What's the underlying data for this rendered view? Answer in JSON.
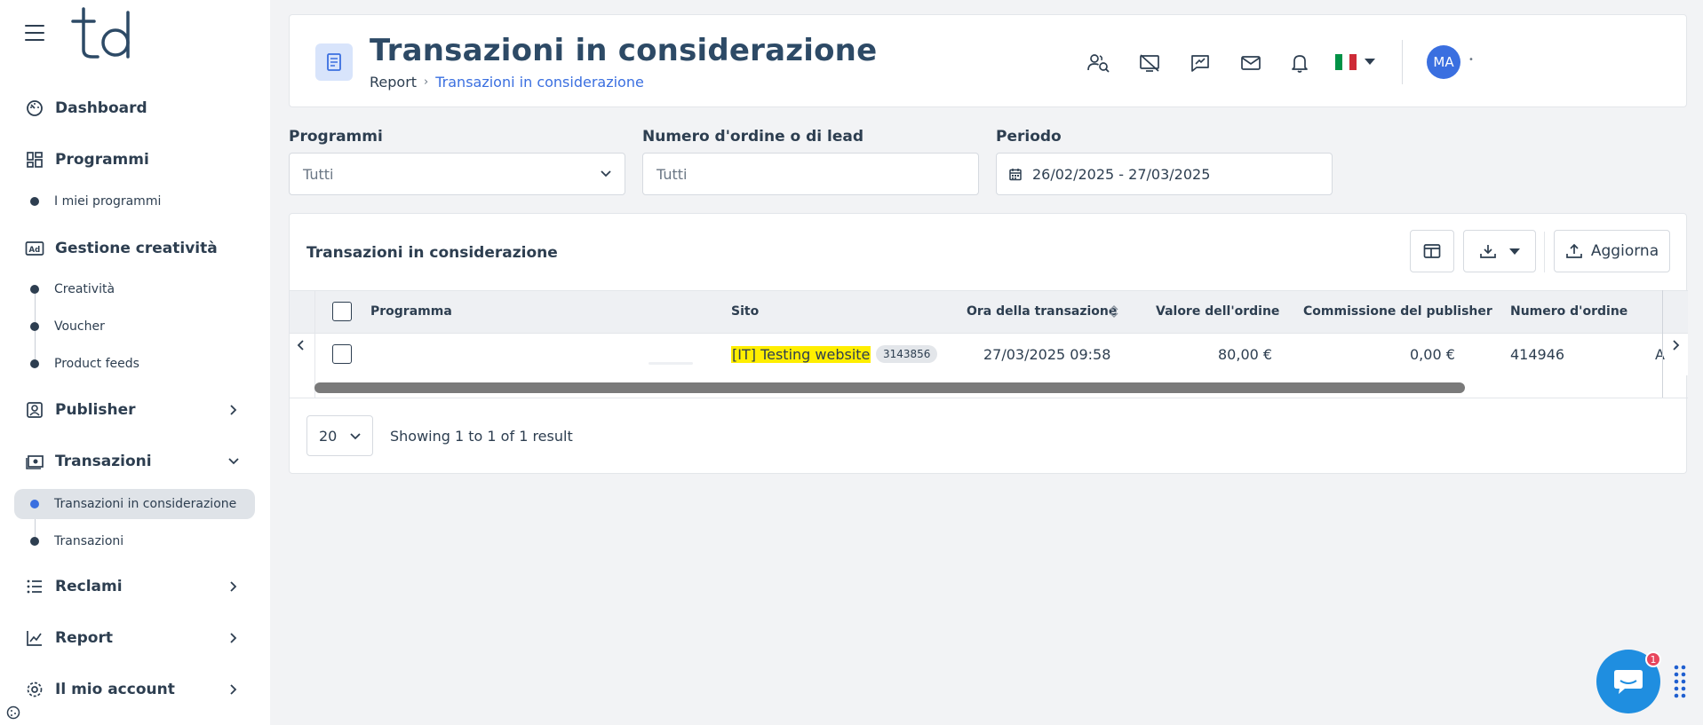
{
  "sidebar": {
    "items": [
      {
        "label": "Dashboard",
        "icon": "dashboard-icon"
      },
      {
        "label": "Programmi",
        "icon": "grid-icon"
      },
      {
        "label": "Gestione creatività",
        "icon": "ad-icon"
      },
      {
        "label": "Publisher",
        "icon": "user-card-icon"
      },
      {
        "label": "Transazioni",
        "icon": "money-icon"
      },
      {
        "label": "Reclami",
        "icon": "list-icon"
      },
      {
        "label": "Report",
        "icon": "chart-icon"
      },
      {
        "label": "Il mio account",
        "icon": "gear-icon"
      }
    ],
    "programmi_sub": [
      "I miei programmi"
    ],
    "creativita_sub": [
      "Creatività",
      "Voucher",
      "Product feeds"
    ],
    "transazioni_sub": [
      "Transazioni in considerazione",
      "Transazioni"
    ],
    "active_item": "Transazioni in considerazione"
  },
  "header": {
    "title": "Transazioni in considerazione",
    "breadcrumb": [
      "Report",
      "Transazioni in considerazione"
    ],
    "avatar_initials": "MA"
  },
  "filters": {
    "programmi": {
      "label": "Programmi",
      "value": "Tutti"
    },
    "ordine": {
      "label": "Numero d'ordine o di lead",
      "placeholder": "Tutti"
    },
    "periodo": {
      "label": "Periodo",
      "value": "26/02/2025 - 27/03/2025"
    }
  },
  "table": {
    "title": "Transazioni in considerazione",
    "refresh_label": "Aggiorna",
    "columns": [
      "Programma",
      "Sito",
      "Ora della transazione",
      "Valore dell'ordine",
      "Commissione del publisher",
      "Numero d'ordine"
    ],
    "rows": [
      {
        "programma": "",
        "sito": "[IT] Testing website",
        "sito_id": "3143856",
        "ora": "27/03/2025 09:58",
        "valore": "80,00 €",
        "commissione": "0,00 €",
        "numero": "414946",
        "overflow": "A"
      }
    ],
    "page_size": "20",
    "showing": "Showing 1 to 1 of 1 result"
  },
  "chat": {
    "badge": "1"
  },
  "colors": {
    "accent": "#3a6fe0",
    "highlight": "#ffee00",
    "chat": "#1f8ee0"
  }
}
